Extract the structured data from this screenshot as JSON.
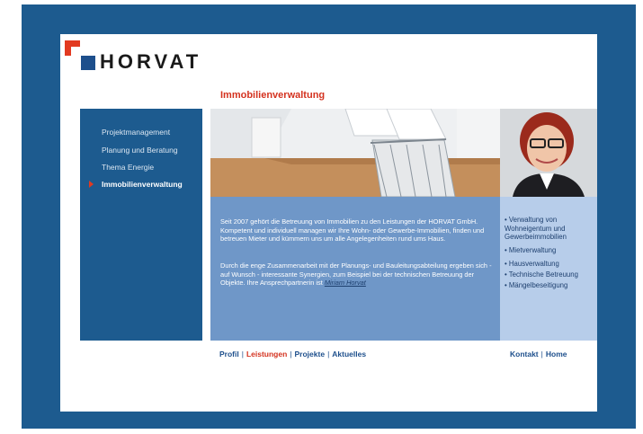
{
  "brand": {
    "name": "HORVAT"
  },
  "section_title": "Immobilienverwaltung",
  "sidebar": {
    "items": [
      {
        "label": "Projektmanagement"
      },
      {
        "label": "Planung und Beratung"
      },
      {
        "label": "Thema Energie"
      },
      {
        "label": "Immobilienverwaltung",
        "active": true
      }
    ]
  },
  "content": {
    "para1": "Seit 2007 gehört die Betreuung von Immobilien zu den Leistungen der HORVAT GmbH. Kompetent und individuell managen wir Ihre Wohn- oder Gewerbe-Immobilien, finden und betreuen Mieter und kümmern uns um alle Angelegenheiten rund ums Haus.",
    "para2": "Durch die enge Zusammenarbeit mit der Planungs- und Bauleitungsabteilung ergeben sich - auf Wunsch - interessante Synergien, zum Beispiel bei der technischen Betreuung der Objekte. Ihre Ansprechpartnerin ist",
    "contact_link": "Miriam Horvat"
  },
  "services": [
    "• Verwaltung von Wohneigentum und Gewerbeimmobilien",
    "• Mietverwaltung",
    "• Hausverwaltung",
    "• Technische Betreuung",
    "• Mängelbeseitigung"
  ],
  "footer_nav": {
    "left": [
      {
        "label": "Profil"
      },
      {
        "label": "Leistungen",
        "active": true
      },
      {
        "label": "Projekte"
      },
      {
        "label": "Aktuelles"
      }
    ],
    "right": [
      {
        "label": "Kontakt"
      },
      {
        "label": "Home"
      }
    ],
    "separator": "|"
  },
  "colors": {
    "frame_blue": "#1d5b8f",
    "accent_red": "#d4321f",
    "panel_mid": "#6f97c8",
    "panel_light": "#b7cdea"
  }
}
